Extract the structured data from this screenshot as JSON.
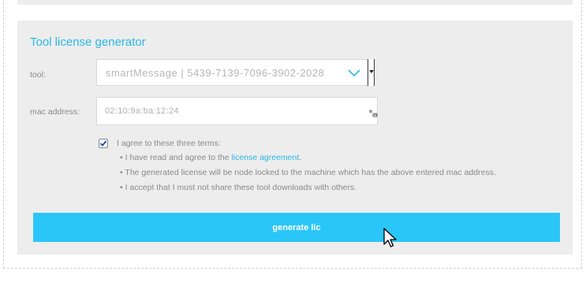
{
  "form": {
    "title": "Tool license generator",
    "tool_label": "tool:",
    "tool_selected": "smartMessage | 5439-7139-7096-3902-2028",
    "mac_label": "mac address:",
    "mac_value": "02:10:9a:ba:12:24",
    "agree_checked": true,
    "agree_label": "I agree to these three terms:",
    "term1_bullet": "•",
    "term1_prefix": "I have read and agree to the ",
    "term1_link": "license agreement",
    "term1_suffix": ".",
    "term2": "• The generated license will be node locked to the machine which has the above entered mac address.",
    "term3": "• I accept that I must not share these tool downloads with others.",
    "generate_label": "generate lic"
  },
  "colors": {
    "accent": "#29b8e8",
    "button": "#2bc6f8",
    "panel": "#ededed"
  },
  "icons": {
    "select": "chevron-down-icon",
    "mac_field": "keyboard-icon",
    "pointer": "cursor-icon"
  }
}
